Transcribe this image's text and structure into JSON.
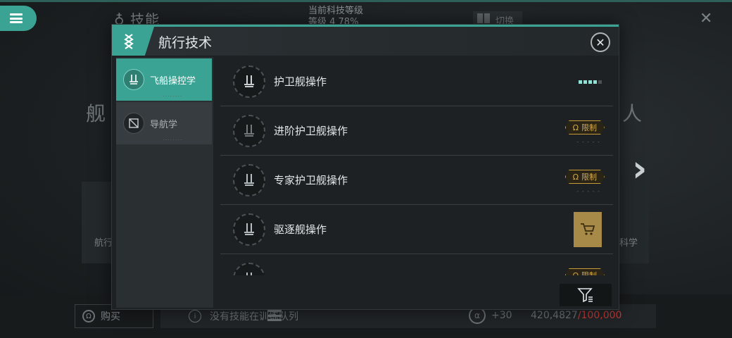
{
  "background": {
    "skill_title": "技能",
    "tech_level_label": "当前科技等级",
    "tech_level_value": "等级 4   78%",
    "switch_label": "切换",
    "big_left_text": "舰",
    "big_right_text": "人",
    "card_left_label": "航行",
    "card_right_label": "科学"
  },
  "modal": {
    "title": "航行技术",
    "categories": [
      {
        "label": "飞船操控学",
        "dots": "........"
      },
      {
        "label": "导航学",
        "dots": "........"
      }
    ],
    "skills": [
      {
        "name": "护卫舰操作",
        "level_filled": 4,
        "level_total": 5
      },
      {
        "name": "进阶护卫舰操作",
        "badge": "限制",
        "dash": "- - - - -"
      },
      {
        "name": "专家护卫舰操作",
        "badge": "限制",
        "dash": "- - - - -"
      },
      {
        "name": "驱逐舰操作"
      },
      {
        "name": "",
        "badge": "限制"
      }
    ]
  },
  "bottom": {
    "buy_label": "购买",
    "queue_text": "没有技能在训练队列",
    "bonus": "+30",
    "sp_current": "420,4827",
    "sp_max": "/100,000"
  },
  "colors": {
    "accent": "#3aa393",
    "badge": "#c79a3a",
    "warning": "#c43a3a"
  }
}
